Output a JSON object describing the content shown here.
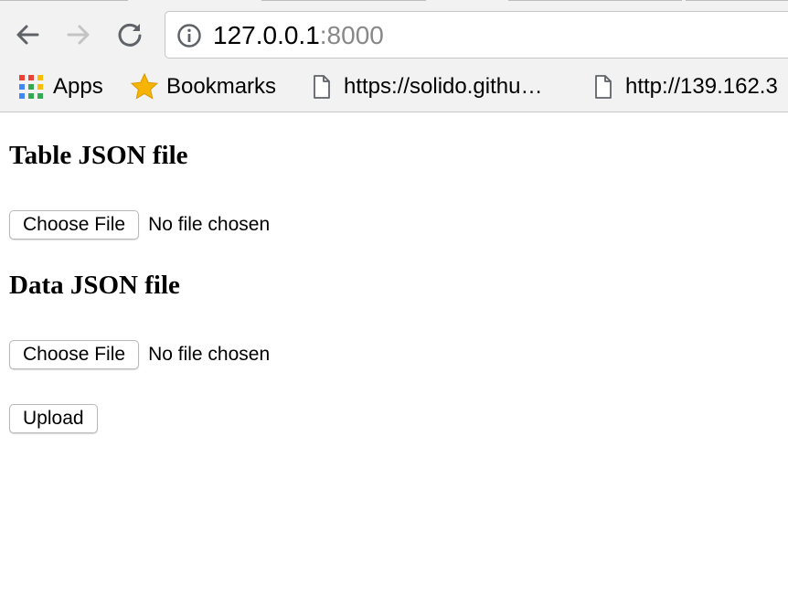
{
  "browser": {
    "address": {
      "host": "127.0.0.1",
      "port": ":8000"
    },
    "bookmarks": [
      {
        "label": "Apps",
        "icon": "apps-grid-icon"
      },
      {
        "label": "Bookmarks",
        "icon": "star-icon"
      },
      {
        "label": "https://solido.githu…",
        "icon": "page-icon"
      },
      {
        "label": "http://139.162.3",
        "icon": "page-icon"
      }
    ],
    "colors": {
      "toolbar": "#f2f2f2",
      "star": "#f6b400"
    }
  },
  "page": {
    "table_heading": "Table JSON file",
    "table_file": {
      "button": "Choose File",
      "status": "No file chosen"
    },
    "data_heading": "Data JSON file",
    "data_file": {
      "button": "Choose File",
      "status": "No file chosen"
    },
    "upload_label": "Upload"
  }
}
